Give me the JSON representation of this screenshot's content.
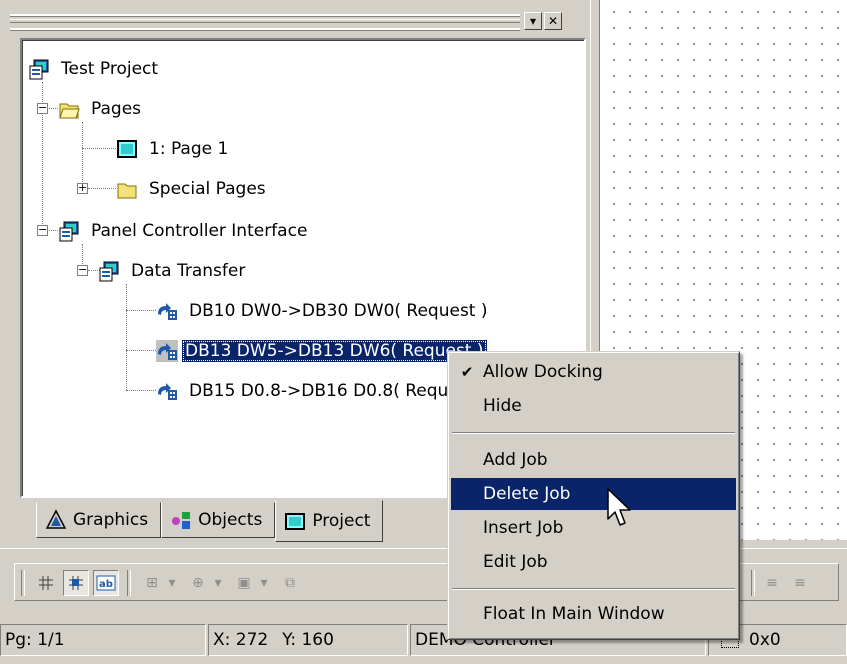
{
  "tree": {
    "nodes": [
      {
        "label": "Test Project",
        "icon": "project-icon"
      },
      {
        "label": "Pages",
        "icon": "open-folder-icon"
      },
      {
        "label": "1: Page 1",
        "icon": "page-icon"
      },
      {
        "label": "Special Pages",
        "icon": "folder-icon"
      },
      {
        "label": "Panel  Controller Interface",
        "icon": "controller-interface-icon"
      },
      {
        "label": "Data Transfer",
        "icon": "data-transfer-icon"
      },
      {
        "label": "DB10 DW0->DB30 DW0( Request )",
        "icon": "transfer-job-icon"
      },
      {
        "label": "DB13 DW5->DB13 DW6( Request )",
        "icon": "transfer-job-icon"
      },
      {
        "label": "DB15 D0.8->DB16 D0.8( Request )",
        "icon": "transfer-job-icon"
      }
    ],
    "selected_index": 7
  },
  "tabs": [
    {
      "label": "Graphics",
      "icon": "graphics-icon"
    },
    {
      "label": "Objects",
      "icon": "objects-icon"
    },
    {
      "label": "Project",
      "icon": "project-tab-icon"
    }
  ],
  "context_menu": {
    "items": [
      {
        "label": "Allow Docking",
        "checked": true
      },
      {
        "label": "Hide"
      },
      {
        "label": "Add Job"
      },
      {
        "label": "Delete Job",
        "highlighted": true
      },
      {
        "label": "Insert Job"
      },
      {
        "label": "Edit Job"
      },
      {
        "label": "Float In Main Window"
      }
    ]
  },
  "status_bar": {
    "page": "Pg: 1/1",
    "x": "X: 272",
    "y": "Y: 160",
    "controller": "DEMO Controller",
    "size": "0x0"
  },
  "colors": {
    "selection": "#0a246a",
    "face": "#d4d0c8"
  }
}
